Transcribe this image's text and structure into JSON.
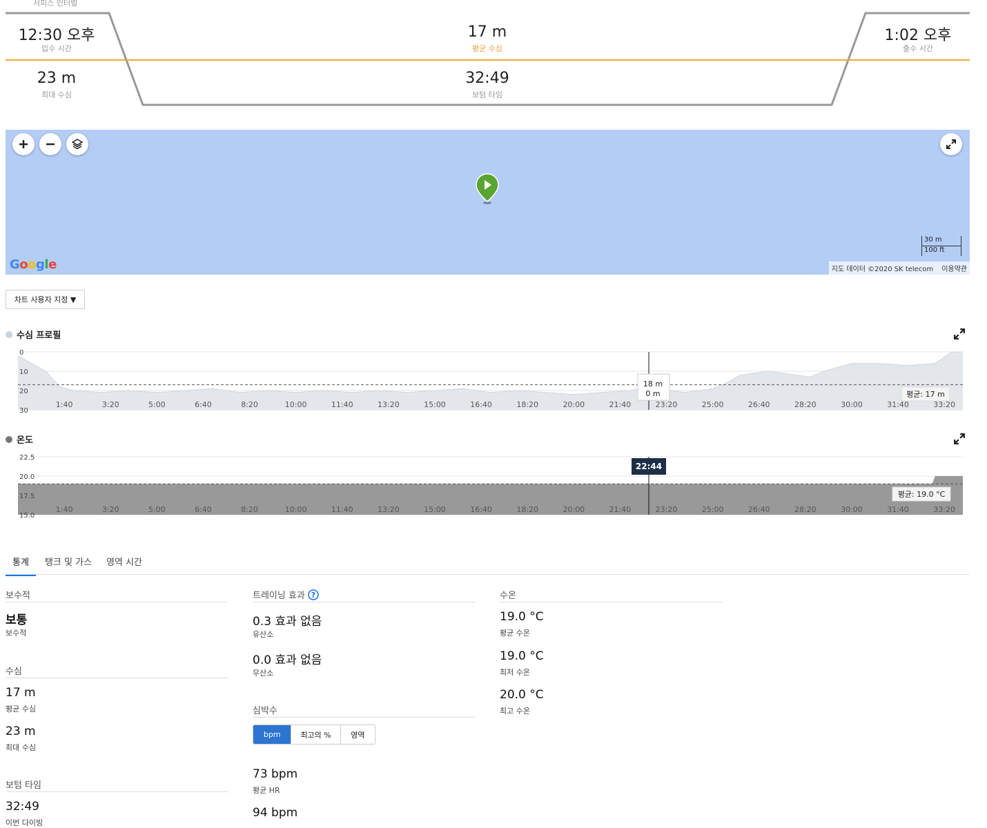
{
  "dive_summary": {
    "top_cut_label": "서피스 인터벌",
    "entry_time": "12:30 오후",
    "entry_time_label": "입수 시간",
    "avg_depth": "17 m",
    "avg_depth_label": "평균 수심",
    "exit_time": "1:02 오후",
    "exit_time_label": "출수 시간",
    "max_depth": "23 m",
    "max_depth_label": "최대 수심",
    "bottom_time": "32:49",
    "bottom_time_label": "보텀 타임"
  },
  "map": {
    "scale_metric": "30 m",
    "scale_imperial": "100 ft",
    "attribution": "지도 데이터 ©2020 SK telecom",
    "terms": "이용약관",
    "logo": "Google",
    "colors": {
      "water": "#b3cdf5",
      "marker": "#5aa532"
    }
  },
  "chart_customize_label": "차트 사용자 지정 ▼",
  "chart_data": [
    {
      "type": "area",
      "title": "수심 프로필",
      "y_ticks": [
        "0",
        "10",
        "20",
        "30"
      ],
      "ylim": [
        0,
        30
      ],
      "y_inverted": true,
      "x_ticks": [
        "1:40",
        "3:20",
        "5:00",
        "6:40",
        "8:20",
        "10:00",
        "11:40",
        "13:20",
        "15:00",
        "16:40",
        "18:20",
        "20:00",
        "21:40",
        "23:20",
        "25:00",
        "26:40",
        "28:20",
        "30:00",
        "31:40",
        "33:20"
      ],
      "x_minutes": [
        0,
        1,
        1.5,
        2,
        3,
        4,
        5,
        6,
        7,
        8,
        9,
        10,
        11,
        12,
        13,
        14,
        15,
        16,
        17,
        18,
        19,
        20,
        21,
        22,
        22.7,
        23,
        24,
        25,
        25.5,
        26,
        27,
        28,
        28.5,
        29,
        30,
        31,
        32,
        33,
        33.6,
        34
      ],
      "y_depth": [
        2,
        10,
        18,
        20,
        21,
        20,
        21,
        20,
        19,
        21,
        20,
        21,
        20,
        21,
        20,
        21,
        20,
        19,
        21,
        20,
        21,
        22,
        21,
        20,
        18,
        19,
        21,
        19,
        16,
        12,
        10,
        12,
        13,
        10,
        6,
        6,
        7,
        6,
        0,
        0
      ],
      "average": 17,
      "average_label": "평균: 17 m",
      "tooltip": {
        "line1": "18 m",
        "line2": "0 m"
      },
      "cursor_minute": 22.7,
      "color": "#d9dee3",
      "dot_color": "#c9d3dc"
    },
    {
      "type": "area",
      "title": "온도",
      "y_ticks": [
        "22.5",
        "20.0",
        "17.5",
        "15.0"
      ],
      "ylim": [
        15.0,
        22.5
      ],
      "x_ticks": [
        "1:40",
        "3:20",
        "5:00",
        "6:40",
        "8:20",
        "10:00",
        "11:40",
        "13:20",
        "15:00",
        "16:40",
        "18:20",
        "20:00",
        "21:40",
        "23:20",
        "25:00",
        "26:40",
        "28:20",
        "30:00",
        "31:40",
        "33:20"
      ],
      "x_minutes": [
        0,
        32.9,
        33.0,
        34
      ],
      "y_temp": [
        19.0,
        19.0,
        20.0,
        20.0
      ],
      "average": 19.0,
      "average_label": "평균: 19.0 °C",
      "cursor_label": "22:44",
      "cursor_minute": 22.7,
      "color": "#999999",
      "dot_color": "#777777"
    }
  ],
  "tabs": [
    "통계",
    "탱크 및 가스",
    "영역 시간"
  ],
  "stats": {
    "conservatism": {
      "header": "보수적",
      "value": "보통",
      "caption": "보수적"
    },
    "depth": {
      "header": "수심",
      "avg": "17 m",
      "avg_caption": "평균 수심",
      "max": "23 m",
      "max_caption": "최대 수심"
    },
    "bottom_time": {
      "header": "보텀 타임",
      "value": "32:49",
      "caption": "이번 다이빙"
    },
    "training": {
      "header": "트레이닝 효과",
      "aerobic": "0.3 효과 없음",
      "aerobic_caption": "유산소",
      "anaerobic": "0.0 효과 없음",
      "anaerobic_caption": "무산소"
    },
    "heart_rate": {
      "header": "심박수",
      "toggle": [
        "bpm",
        "최고의 %",
        "영역"
      ],
      "avg": "73 bpm",
      "avg_caption": "평균 HR",
      "max": "94 bpm"
    },
    "water_temp": {
      "header": "수온",
      "avg": "19.0 °C",
      "avg_caption": "평균 수온",
      "min": "19.0 °C",
      "min_caption": "최저 수온",
      "max": "20.0 °C",
      "max_caption": "최고 수온"
    }
  }
}
